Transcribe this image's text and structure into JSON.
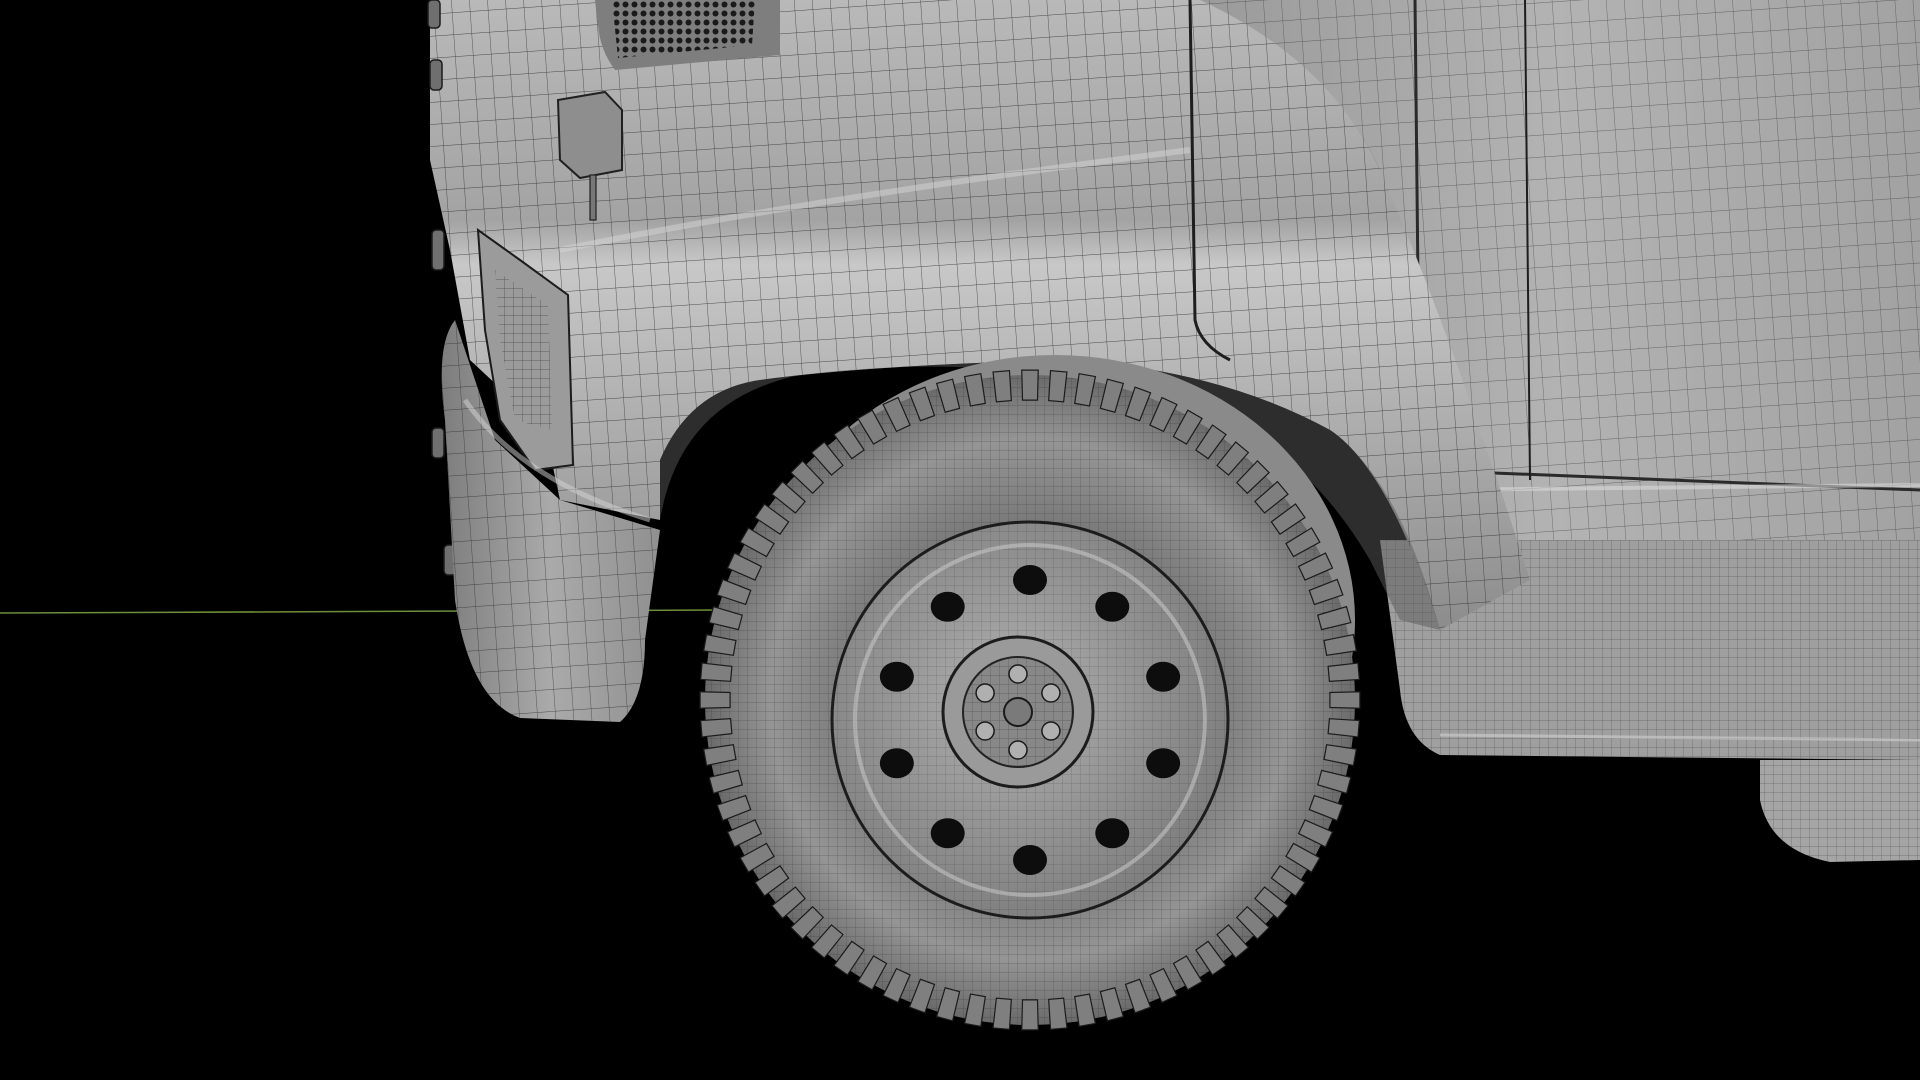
{
  "viewport": {
    "view_mode": "wireframe-on-shaded",
    "background_color": "#000000",
    "subject": "truck-front-wheel"
  },
  "colors": {
    "shaded_body": "#a9a9a9",
    "body_highlight": "#c7c7c7",
    "body_shadow": "#6e6e6e",
    "wire": "#1f1f1f",
    "ground_axis": "#6b8f3a"
  },
  "elements": {
    "ground_axis_line": "grid-x-axis",
    "grille": "grille-mesh",
    "mirror_mount": "mirror-mount",
    "headlight": "headlight",
    "front_bumper": "bumper",
    "front_fender": "fender",
    "door_panel": "door",
    "side_step": "step",
    "tire": "tire",
    "wheel_rim": "rim",
    "hub_cap": "hub"
  },
  "wheel": {
    "rim_holes": 10,
    "lug_nuts": 6
  }
}
